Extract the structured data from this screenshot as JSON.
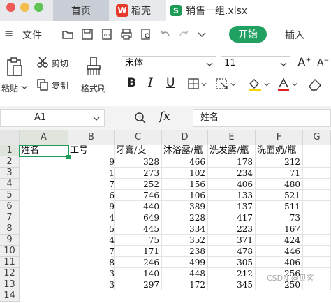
{
  "window": {
    "tabs": [
      {
        "label": "首页"
      },
      {
        "label": "稻壳"
      },
      {
        "label": "销售一组.xlsx"
      }
    ],
    "traffic_colors": [
      "#ee5b55",
      "#f4be4f",
      "#5fc454"
    ]
  },
  "menu": {
    "hamburger_label": "≡",
    "file_label": "文件",
    "start_label": "开始",
    "insert_label": "插入",
    "accent": "#20a162"
  },
  "ribbon": {
    "paste_label": "粘贴",
    "cut_label": "剪切",
    "copy_label": "复制",
    "format_painter_label": "格式刷",
    "font_name": "宋体",
    "font_size": "11",
    "bold": "B",
    "italic": "I",
    "underline": "U"
  },
  "formula_bar": {
    "name_box": "A1",
    "fx_label": "fx",
    "formula": "姓名"
  },
  "sheet": {
    "columns": [
      "A",
      "B",
      "C",
      "D",
      "E",
      "F",
      "G"
    ],
    "row_numbers": [
      "1",
      "2",
      "3",
      "4",
      "5",
      "6",
      "7",
      "8",
      "9",
      "10",
      "11",
      "12",
      "13",
      "14"
    ],
    "header_row": [
      "姓名",
      "工号",
      "牙膏/支",
      "沐浴露/瓶",
      "洗发露/瓶",
      "洗面奶/瓶"
    ],
    "rows": [
      [
        "",
        "",
        "328",
        "466",
        "178",
        "212"
      ],
      [
        "",
        "",
        "273",
        "102",
        "234",
        "71"
      ],
      [
        "",
        "",
        "252",
        "156",
        "406",
        "480"
      ],
      [
        "",
        "",
        "746",
        "106",
        "133",
        "521"
      ],
      [
        "",
        "",
        "440",
        "389",
        "137",
        "511"
      ],
      [
        "",
        "",
        "649",
        "228",
        "417",
        "73"
      ],
      [
        "",
        "",
        "445",
        "334",
        "223",
        "167"
      ],
      [
        "",
        "",
        "75",
        "352",
        "371",
        "424"
      ],
      [
        "",
        "",
        "171",
        "238",
        "478",
        "446"
      ],
      [
        "",
        "",
        "246",
        "499",
        "305",
        "406"
      ],
      [
        "",
        "",
        "140",
        "448",
        "212",
        "256"
      ],
      [
        "",
        "",
        "297",
        "172",
        "345",
        "250"
      ]
    ],
    "partial_b_digits": [
      "9",
      "1",
      "7",
      "6",
      "9",
      "4",
      "5",
      "4",
      "7",
      "8",
      "3",
      "3"
    ]
  },
  "watermark": "CSDN @贝客"
}
